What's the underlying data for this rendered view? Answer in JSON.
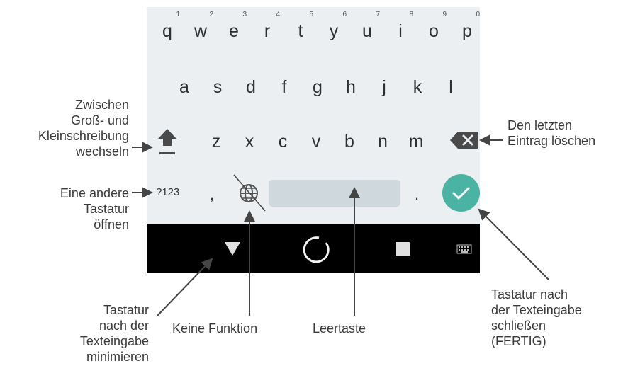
{
  "keyboard": {
    "row1": [
      {
        "key": "q",
        "hint": "1"
      },
      {
        "key": "w",
        "hint": "2"
      },
      {
        "key": "e",
        "hint": "3"
      },
      {
        "key": "r",
        "hint": "4"
      },
      {
        "key": "t",
        "hint": "5"
      },
      {
        "key": "y",
        "hint": "6"
      },
      {
        "key": "u",
        "hint": "7"
      },
      {
        "key": "i",
        "hint": "8"
      },
      {
        "key": "o",
        "hint": "9"
      },
      {
        "key": "p",
        "hint": "0"
      }
    ],
    "row2": [
      "a",
      "s",
      "d",
      "f",
      "g",
      "h",
      "j",
      "k",
      "l"
    ],
    "row3": [
      "z",
      "x",
      "c",
      "v",
      "b",
      "n",
      "m"
    ],
    "sym_label": "?123",
    "comma": ",",
    "period": ".",
    "colors": {
      "background": "#eceff1",
      "spacebar": "#cfd8dc",
      "done": "#4ab3a3",
      "navbar": "#000000"
    },
    "icons": [
      "shift-icon",
      "backspace-icon",
      "globe-icon",
      "check-icon",
      "back-triangle-icon",
      "home-circle-icon",
      "recents-square-icon",
      "keyboard-switch-icon"
    ]
  },
  "annotations": {
    "shift": [
      "Zwischen",
      "Groß- und",
      "Kleinschreibung",
      "wechseln"
    ],
    "other_keyboard": [
      "Eine andere",
      "Tastatur",
      "öffnen"
    ],
    "backspace": [
      "Den letzten",
      "Eintrag löschen"
    ],
    "minimize": [
      "Tastatur",
      "nach der",
      "Texteingabe",
      "minimieren"
    ],
    "no_function": "Keine Funktion",
    "space": "Leertaste",
    "done": [
      "Tastatur nach",
      "der Texteingabe",
      "schließen",
      "(FERTIG)"
    ]
  }
}
